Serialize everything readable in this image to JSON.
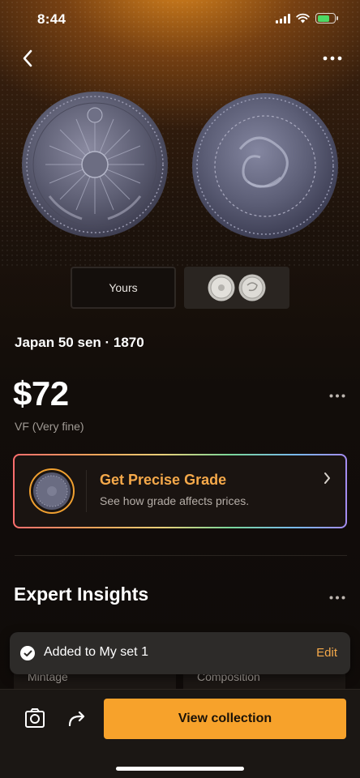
{
  "status_bar": {
    "time": "8:44"
  },
  "nav": {
    "back_icon": "chevron-left-icon",
    "more_icon": "more-horizontal-icon"
  },
  "coin_images": {
    "obverse": "coin-obverse-image",
    "reverse": "coin-reverse-image"
  },
  "image_tabs": {
    "yours_label": "Yours"
  },
  "coin": {
    "title": "Japan 50 sen · 1870",
    "price": "$72",
    "grade": "VF (Very fine)"
  },
  "grade_card": {
    "title": "Get Precise Grade",
    "subtitle": "See how grade affects prices."
  },
  "expert_insights": {
    "title": "Expert Insights",
    "cards": [
      {
        "label": "Mintage"
      },
      {
        "label": "Composition"
      }
    ]
  },
  "toast": {
    "message": "Added to My set 1",
    "action": "Edit"
  },
  "bottom_bar": {
    "view_collection_label": "View collection"
  },
  "colors": {
    "accent": "#f7a22b",
    "accent_text": "#f5a94a",
    "background": "#0f0b09",
    "battery_green": "#4cd964"
  }
}
